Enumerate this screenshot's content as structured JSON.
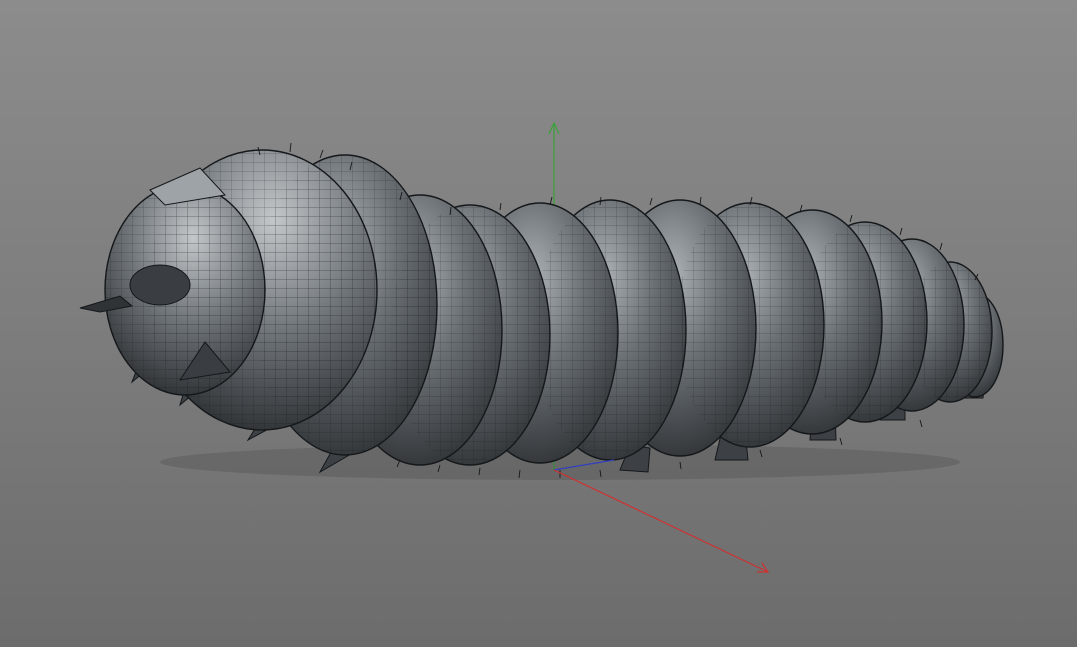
{
  "viewport": {
    "background_top": "#8c8c8c",
    "background_bottom": "#6c6c6c"
  },
  "model": {
    "shape": "caterpillar-larva",
    "display": "shaded-with-wireframe",
    "segments": 11,
    "body_color": "#5f6468",
    "wire_color": "#15181a"
  },
  "gizmo": {
    "x_axis_color": "#d03030",
    "y_axis_color": "#3aa23a",
    "z_axis_color": "#3040c0"
  }
}
